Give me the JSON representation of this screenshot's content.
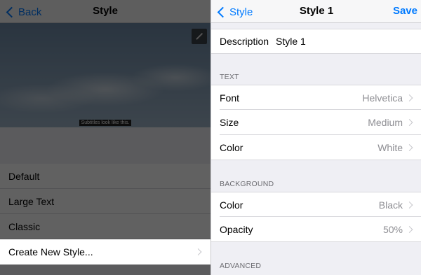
{
  "left": {
    "nav": {
      "back_label": "Back",
      "title": "Style"
    },
    "preview": {
      "subtitle_text": "Subtitles look like this."
    },
    "styles": [
      {
        "label": "Default"
      },
      {
        "label": "Large Text"
      },
      {
        "label": "Classic"
      }
    ],
    "create_new_label": "Create New Style..."
  },
  "right": {
    "nav": {
      "back_label": "Style",
      "title": "Style 1",
      "save_label": "Save"
    },
    "description": {
      "label": "Description",
      "value": "Style 1"
    },
    "text_section": {
      "header": "TEXT",
      "rows": [
        {
          "label": "Font",
          "value": "Helvetica"
        },
        {
          "label": "Size",
          "value": "Medium"
        },
        {
          "label": "Color",
          "value": "White"
        }
      ]
    },
    "background_section": {
      "header": "BACKGROUND",
      "rows": [
        {
          "label": "Color",
          "value": "Black"
        },
        {
          "label": "Opacity",
          "value": "50%"
        }
      ]
    },
    "advanced_section": {
      "header": "ADVANCED"
    }
  },
  "colors": {
    "accent": "#007aff",
    "group_bg": "#efeff4",
    "secondary_text": "#8e8e93"
  }
}
